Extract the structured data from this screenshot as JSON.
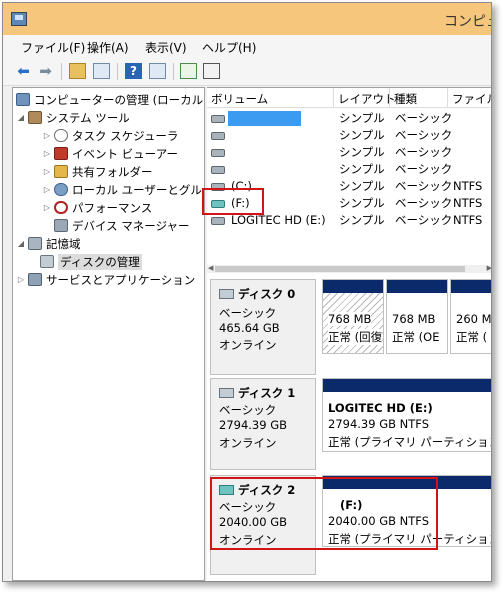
{
  "window": {
    "title": "コンピュ"
  },
  "menu": [
    "ファイル(F)",
    "操作(A)",
    "表示(V)",
    "ヘルプ(H)"
  ],
  "toolbar": {
    "icons": [
      "back-arrow-icon",
      "forward-arrow-icon",
      "up-folder-icon",
      "show-hide-tree-icon",
      "help-icon",
      "show-hide-action-icon",
      "refresh-icon",
      "properties-icon"
    ]
  },
  "tree": {
    "root": "コンピューターの管理 (ローカル)",
    "system_tools": "システム ツール",
    "task_scheduler": "タスク スケジューラ",
    "event_viewer": "イベント ビューアー",
    "shared_folders": "共有フォルダー",
    "local_users": "ローカル ユーザーとグループ",
    "performance": "パフォーマンス",
    "device_manager": "デバイス マネージャー",
    "storage": "記憶域",
    "disk_management": "ディスクの管理",
    "services": "サービスとアプリケーション"
  },
  "volumes": {
    "headers": [
      "ボリューム",
      "レイアウト",
      "種類",
      "ファイル"
    ],
    "rows": [
      {
        "name": "",
        "layout": "シンプル",
        "type": "ベーシック",
        "fs": ""
      },
      {
        "name": "",
        "layout": "シンプル",
        "type": "ベーシック",
        "fs": ""
      },
      {
        "name": "",
        "layout": "シンプル",
        "type": "ベーシック",
        "fs": ""
      },
      {
        "name": "",
        "layout": "シンプル",
        "type": "ベーシック",
        "fs": ""
      },
      {
        "name": "(C:)",
        "layout": "シンプル",
        "type": "ベーシック",
        "fs": "NTFS"
      },
      {
        "name": "(F:)",
        "layout": "シンプル",
        "type": "ベーシック",
        "fs": "NTFS"
      },
      {
        "name": "LOGITEC HD (E:)",
        "layout": "シンプル",
        "type": "ベーシック",
        "fs": "NTFS"
      }
    ]
  },
  "disks": [
    {
      "name": "ディスク 0",
      "type": "ベーシック",
      "size": "465.64 GB",
      "status": "オンライン",
      "partitions": [
        {
          "size": "768 MB",
          "status": "正常 (回復"
        },
        {
          "size": "768 MB",
          "status": "正常 (OE"
        },
        {
          "size": "260 M",
          "status": "正常 ("
        }
      ]
    },
    {
      "name": "ディスク 1",
      "type": "ベーシック",
      "size": "2794.39 GB",
      "status": "オンライン",
      "partition": {
        "label": "LOGITEC HD  (E:)",
        "size": "2794.39 GB NTFS",
        "status": "正常 (プライマリ パーティション)"
      }
    },
    {
      "name": "ディスク 2",
      "type": "ベーシック",
      "size": "2040.00 GB",
      "status": "オンライン",
      "partition": {
        "label": "(F:)",
        "size": "2040.00 GB NTFS",
        "status": "正常 (プライマリ パーティション)"
      }
    }
  ],
  "colors": {
    "highlight_red": "#d11414",
    "partition_bar": "#0a2a6b",
    "selection_blue": "#3a9bf0",
    "titlebar": "#f5c67c"
  }
}
